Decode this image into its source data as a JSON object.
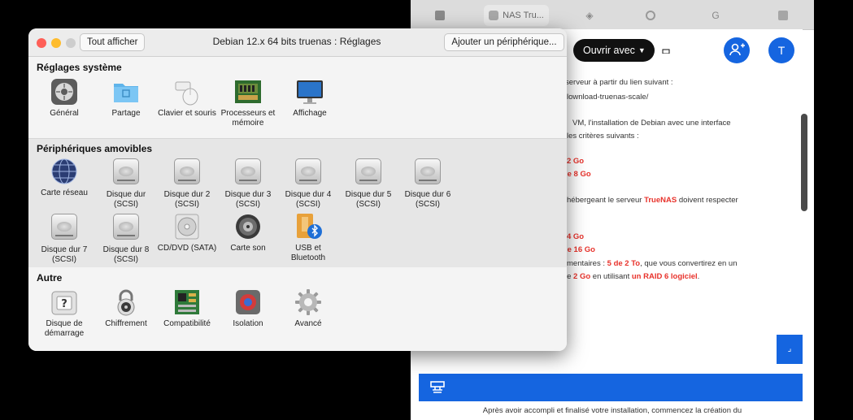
{
  "browser": {
    "tabs": [
      {
        "label": "",
        "icon": "doc-icon"
      },
      {
        "label": "NAS Tru...",
        "icon": "drive-icon"
      },
      {
        "label": "",
        "icon": "diamond-icon"
      },
      {
        "label": "",
        "icon": "c-icon"
      },
      {
        "label": "",
        "icon": "g-icon"
      },
      {
        "label": "",
        "icon": "t-icon"
      }
    ],
    "open_with_label": "Ouvrir avec",
    "avatar_letter": "T",
    "doc_lines": [
      {
        "text": "serveur   à   partir   du   lien   suivant   :"
      },
      {
        "text": "lownload-truenas-scale/"
      },
      {
        "text": "VM, l'installation de Debian avec une interface"
      },
      {
        "text": "les critères suivants :"
      },
      {
        "text": "2 Go",
        "red": true
      },
      {
        "text": "le 8 Go",
        "red": true
      },
      {
        "text": "hébergeant le serveur "
      },
      {
        "text": "4 Go",
        "red": true
      },
      {
        "text": "le 16 Go",
        "red": true
      }
    ],
    "truenas_word": "TrueNAS",
    "respect_text": " doivent respecter",
    "disk_line_prefix": "mentaires : ",
    "disk_line_red": "5 de 2 To",
    "disk_line_suffix": ", que vous convertirez en un",
    "raid_line_prefix": "le ",
    "raid_line_red1": "2 Go",
    "raid_line_mid": " en utilisant ",
    "raid_line_red2": "un RAID 6 logiciel",
    "raid_line_end": ".",
    "footer_text": "Après avoir accompli et finalisé votre installation, commencez la création du",
    "accent_color": "#1565e0"
  },
  "window": {
    "show_all": "Tout afficher",
    "title": "Debian 12.x 64 bits truenas : Réglages",
    "add_device": "Ajouter un périphérique...",
    "sections": [
      {
        "title": "Réglages système",
        "items": [
          {
            "label": "Général",
            "icon": "gear-icon"
          },
          {
            "label": "Partage",
            "icon": "shared-folder-icon"
          },
          {
            "label": "Clavier et souris",
            "icon": "keyboard-mouse-icon"
          },
          {
            "label": "Processeurs et mémoire",
            "icon": "chip-icon"
          },
          {
            "label": "Affichage",
            "icon": "display-icon"
          }
        ]
      },
      {
        "title": "Périphériques amovibles",
        "items": [
          {
            "label": "Carte réseau",
            "icon": "globe-icon"
          },
          {
            "label": "Disque dur (SCSI)",
            "icon": "hard-disk-icon"
          },
          {
            "label": "Disque dur 2 (SCSI)",
            "icon": "hard-disk-icon"
          },
          {
            "label": "Disque dur 3 (SCSI)",
            "icon": "hard-disk-icon"
          },
          {
            "label": "Disque dur 4 (SCSI)",
            "icon": "hard-disk-icon"
          },
          {
            "label": "Disque dur 5 (SCSI)",
            "icon": "hard-disk-icon"
          },
          {
            "label": "Disque dur 6 (SCSI)",
            "icon": "hard-disk-icon"
          },
          {
            "label": "Disque dur 7 (SCSI)",
            "icon": "hard-disk-icon"
          },
          {
            "label": "Disque dur 8 (SCSI)",
            "icon": "hard-disk-icon"
          },
          {
            "label": "CD/DVD (SATA)",
            "icon": "cd-icon"
          },
          {
            "label": "Carte son",
            "icon": "speaker-icon"
          },
          {
            "label": "USB et Bluetooth",
            "icon": "usb-bluetooth-icon"
          }
        ]
      },
      {
        "title": "Autre",
        "items": [
          {
            "label": "Disque de démarrage",
            "icon": "startup-disk-icon"
          },
          {
            "label": "Chiffrement",
            "icon": "lock-icon"
          },
          {
            "label": "Compatibilité",
            "icon": "motherboard-icon"
          },
          {
            "label": "Isolation",
            "icon": "isolation-icon"
          },
          {
            "label": "Avancé",
            "icon": "advanced-gear-icon"
          }
        ]
      }
    ]
  }
}
